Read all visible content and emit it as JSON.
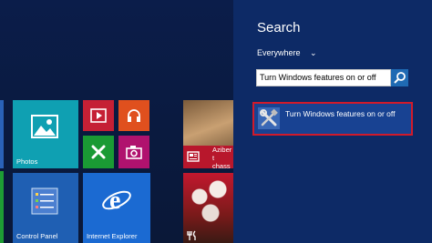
{
  "start_screen": {
    "tiles": [
      {
        "label": "Photos",
        "icon": "photos-icon"
      },
      {
        "label": "",
        "icon": "video-icon"
      },
      {
        "label": "",
        "icon": "music-icon"
      },
      {
        "label": "",
        "icon": "games-icon"
      },
      {
        "label": "",
        "icon": "camera-icon"
      },
      {
        "label": "Control Panel",
        "icon": "control-panel-icon"
      },
      {
        "label": "Internet Explorer",
        "icon": "internet-explorer-icon"
      },
      {
        "label": "Azibert chasse",
        "icon": "news-icon"
      },
      {
        "label": "",
        "icon": "food-icon"
      }
    ]
  },
  "search_panel": {
    "title": "Search",
    "scope": "Everywhere",
    "query": "Turn Windows features on or off",
    "search_button_icon": "search-icon",
    "results": [
      {
        "label": "Turn Windows features on or off",
        "icon": "tools-icon"
      }
    ]
  },
  "colors": {
    "panel_bg": "#0d2a66",
    "highlight_border": "#d11a2a",
    "accent": "#1f6ab3"
  }
}
